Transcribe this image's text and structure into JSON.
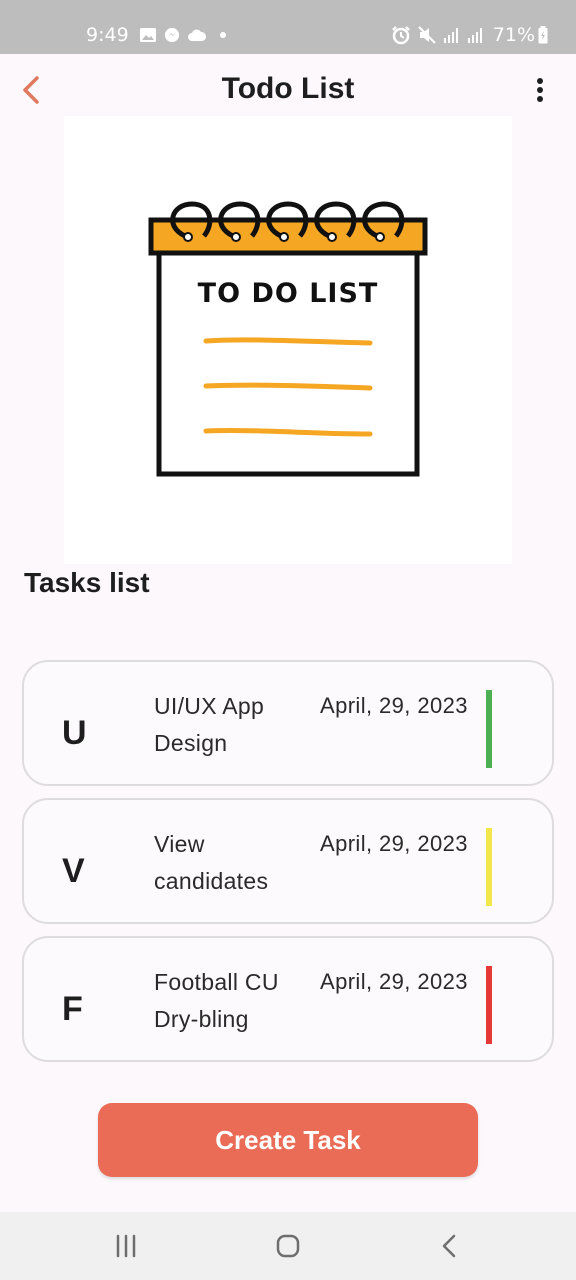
{
  "status_bar": {
    "time": "9:49",
    "battery": "71%"
  },
  "app_bar": {
    "title": "Todo List",
    "accent_color": "#e07a5f"
  },
  "illustration": {
    "text": "TO DO LIST",
    "accent_color": "#f5a623"
  },
  "tasks_section": {
    "title": "Tasks list"
  },
  "tasks": [
    {
      "initial": "U",
      "title": "UI/UX App Design",
      "date": "April, 29, 2023",
      "color": "#4caf50"
    },
    {
      "initial": "V",
      "title": "View candidates",
      "date": "April, 29, 2023",
      "color": "#f3e64a"
    },
    {
      "initial": "F",
      "title": "Football CU Dry-bling",
      "date": "April, 29, 2023",
      "color": "#e53935"
    }
  ],
  "create_button": {
    "label": "Create Task",
    "color": "#ea6b56"
  }
}
